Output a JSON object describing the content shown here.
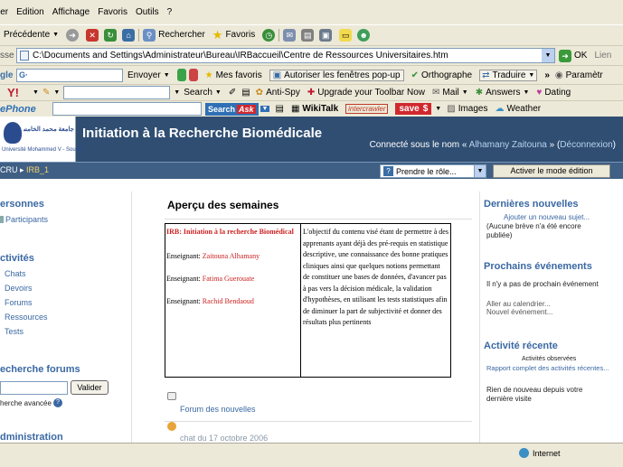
{
  "menu": [
    "ier",
    "Edition",
    "Affichage",
    "Favoris",
    "Outils",
    "?"
  ],
  "toolbar": {
    "back": "Précédente",
    "search": "Rechercher",
    "favorites": "Favoris"
  },
  "address": {
    "label": "sse",
    "url": "C:\\Documents and Settings\\Administrateur\\Bureau\\IRBaccueil\\Centre de Ressources Universitaires.htm",
    "go": "OK",
    "links": "Lien"
  },
  "google_bar": {
    "logo": "gle",
    "search_prefix": "G·",
    "send": "Envoyer",
    "favorites": "Mes favoris",
    "popup": "Autoriser les fenêtres pop-up",
    "spelling": "Orthographe",
    "translate": "Traduire",
    "params": "Paramètr"
  },
  "yahoo_bar": {
    "logo": "Y!",
    "search": "Search",
    "antispy": "Anti-Spy",
    "upgrade": "Upgrade your Toolbar Now",
    "mail": "Mail",
    "answers": "Answers",
    "dating": "Dating"
  },
  "phone_bar": {
    "logo": "ePhone",
    "search": "Search",
    "ask": "Ask",
    "wikitalk": "WikiTalk",
    "intercrawler": "intercrawler",
    "save": "save",
    "images": "Images",
    "weather": "Weather"
  },
  "site": {
    "logo_ar": "جامعة محمد الخامس السويسي",
    "logo_sub": "Université Mohammed V - Souissi",
    "title": "Initiation à la Recherche Biomédicale",
    "logged_prefix": "Connecté sous le nom « ",
    "user": "Alhamany Zaitouna",
    "logged_sep": " » (",
    "logout": "Déconnexion",
    "logged_suffix": ")"
  },
  "nav": {
    "crumb_left": "CRU",
    "crumb_sep": " ▸ ",
    "crumb_course": "IRB_1",
    "role_select": "Prendre le rôle...",
    "edit_button": "Activer le mode édition"
  },
  "left": {
    "persons_head": "ersonnes",
    "participants": "Participants",
    "activities_head": "ctivités",
    "activities": [
      "Chats",
      "Devoirs",
      "Forums",
      "Ressources",
      "Tests"
    ],
    "search_head": "echerche forums",
    "go": "Valider",
    "advanced": "herche avancée",
    "admin_head": "dministration"
  },
  "main": {
    "weeks_title": "Aperçu des semaines",
    "course_name": "IRB: Initiation à la recherche Biomédical",
    "teacher_label": "Enseignant: ",
    "teachers": [
      "Zaitouna Alhamany",
      "Fatima Guerouate",
      "Rachid Bendaoud"
    ],
    "objective": "L'objectif du contenu visé étant de permettre à des apprenants ayant déjà des pré-requis en statistique descriptive, une connaissance des bonne pratiques cliniques ainsi que quelques notions permettant de constituer une bases de données, d'avancer pas à pas vers la décision médicale, la validation d'hypothèses, en utilisant les tests statistiques afin de diminuer la part de subjectivité et donner des résultats plus pertinents",
    "forum_news": "Forum des nouvelles",
    "chat": "chat du 17 octobre 2006"
  },
  "right": {
    "news_head": "Dernières nouvelles",
    "add_topic": "Ajouter un nouveau sujet...",
    "no_news": "(Aucune brève n'a été encore publiée)",
    "events_head": "Prochains événements",
    "no_events": "Il n'y a pas de prochain événement",
    "calendar": "Aller au calendrier...",
    "new_event": "Nouvel événement...",
    "recent_head": "Activité récente",
    "watched": "Activités observées",
    "full_report": "Rapport complet des activités récentes...",
    "nothing_new": "Rien de nouveau depuis votre dernière visite"
  },
  "status": {
    "zone": "Internet"
  }
}
